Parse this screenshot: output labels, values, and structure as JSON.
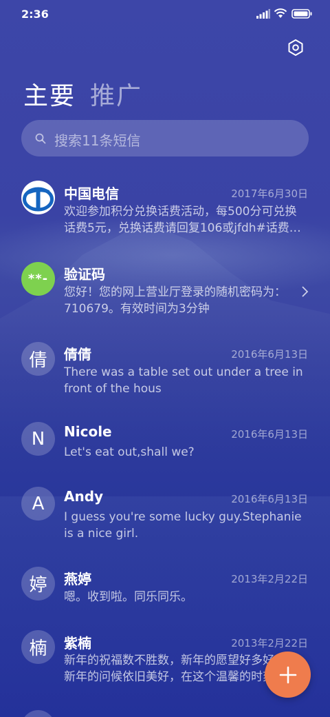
{
  "status_bar": {
    "time": "2:36"
  },
  "tabs": {
    "primary": "主要",
    "promotions": "推广"
  },
  "search": {
    "placeholder": "搜索11条短信"
  },
  "messages": [
    {
      "sender": "中国电信",
      "date": "2017年6月30日",
      "preview": "欢迎参加积分兑换话费活动，每500分可兑换话费5元，兑换话费请回复106或jfdh#话费…",
      "avatar": "china-telecom-logo"
    },
    {
      "sender": "验证码",
      "date": "",
      "preview": "您好！您的网上营业厅登录的随机密码为：710679。有效时间为3分钟",
      "avatar": "**-"
    },
    {
      "sender": "倩倩",
      "date": "2016年6月13日",
      "preview": "There was a table set out under a tree in front of the hous",
      "avatar": "倩"
    },
    {
      "sender": "Nicole",
      "date": "2016年6月13日",
      "preview": "Let's eat out,shall we?",
      "avatar": "N"
    },
    {
      "sender": "Andy",
      "date": "2016年6月13日",
      "preview": "I guess you're some lucky guy.Stephanie is a nice girl.",
      "avatar": "A"
    },
    {
      "sender": "燕婷",
      "date": "2013年2月22日",
      "preview": "嗯。收到啦。同乐同乐。",
      "avatar": "婷"
    },
    {
      "sender": "紫楠",
      "date": "2013年2月22日",
      "preview": "新年的祝福数不胜数，新年的愿望好多好多，新年的问候依旧美好，在这个温馨的时刻",
      "avatar": "楠"
    }
  ],
  "colors": {
    "fab": "#ef7c4d",
    "verification_avatar": "#7ed14f",
    "background": "#2e3b9d"
  }
}
